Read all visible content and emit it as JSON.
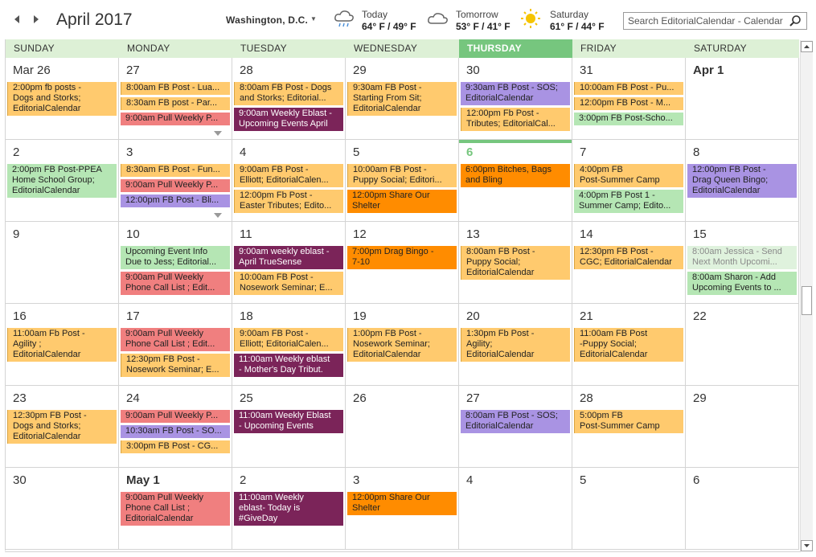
{
  "header": {
    "month_title": "April 2017",
    "location": "Washington,  D.C.",
    "weather": [
      {
        "label": "Today",
        "temp": "64° F / 49° F",
        "icon": "rain-cloud-icon"
      },
      {
        "label": "Tomorrow",
        "temp": "53° F / 41° F",
        "icon": "cloud-icon"
      },
      {
        "label": "Saturday",
        "temp": "61° F / 44° F",
        "icon": "sun-icon"
      }
    ],
    "search_placeholder": "Search EditorialCalendar - Calendar ..."
  },
  "days_of_week": [
    "SUNDAY",
    "MONDAY",
    "TUESDAY",
    "WEDNESDAY",
    "THURSDAY",
    "FRIDAY",
    "SATURDAY"
  ],
  "today_index": 4,
  "colors": {
    "yellow": "#ffca6e",
    "red": "#f07f7f",
    "purple": "#a993e3",
    "plum": "#7b2459",
    "orange": "#ff8c00",
    "green": "#b5e6b4",
    "today_green": "#76c67e",
    "header_bg": "#ddf0d6"
  },
  "weeks": [
    {
      "days": [
        {
          "label": "Mar 26",
          "events": [
            {
              "text": "2:00pm fb posts -\nDogs and Storks;\nEditorialCalendar",
              "color": "yellow",
              "lines": 3
            }
          ]
        },
        {
          "label": "27",
          "more": true,
          "events": [
            {
              "text": "8:00am FB Post - Lua...",
              "color": "yellow",
              "lines": 1
            },
            {
              "text": "8:30am FB post - Par...",
              "color": "yellow",
              "lines": 1
            },
            {
              "text": "9:00am Pull Weekly P...",
              "color": "red",
              "lines": 1
            }
          ]
        },
        {
          "label": "28",
          "events": [
            {
              "text": "8:00am FB Post - Dogs\nand Storks; Editorial...",
              "color": "yellow",
              "lines": 2
            },
            {
              "text": "9:00am Weekly Eblast -\nUpcoming Events April",
              "color": "plum",
              "lines": 2
            }
          ]
        },
        {
          "label": "29",
          "events": [
            {
              "text": "9:30am FB Post -\nStarting From Sit;\nEditorialCalendar",
              "color": "yellow",
              "lines": 3
            }
          ]
        },
        {
          "label": "30",
          "events": [
            {
              "text": "9:30am FB Post - SOS;\nEditorialCalendar",
              "color": "purple",
              "lines": 2
            },
            {
              "text": "12:00pm Fb Post -\nTributes; EditorialCal...",
              "color": "yellow",
              "lines": 2
            }
          ]
        },
        {
          "label": "31",
          "events": [
            {
              "text": "10:00am FB Post - Pu...",
              "color": "yellow",
              "lines": 1
            },
            {
              "text": "12:00pm FB Post - M...",
              "color": "yellow",
              "lines": 1
            },
            {
              "text": "3:00pm FB Post-Scho...",
              "color": "green",
              "lines": 1
            }
          ]
        },
        {
          "label": "Apr 1",
          "bold": true,
          "events": []
        }
      ]
    },
    {
      "days": [
        {
          "label": "2",
          "events": [
            {
              "text": "2:00pm FB Post-PPEA\nHome School Group;\nEditorialCalendar",
              "color": "green",
              "lines": 3
            }
          ]
        },
        {
          "label": "3",
          "more": true,
          "events": [
            {
              "text": "8:30am FB Post - Fun...",
              "color": "yellow",
              "lines": 1
            },
            {
              "text": "9:00am Pull Weekly P...",
              "color": "red",
              "lines": 1
            },
            {
              "text": "12:00pm FB Post - Bli...",
              "color": "purple",
              "lines": 1
            }
          ]
        },
        {
          "label": "4",
          "events": [
            {
              "text": "9:00am FB Post -\nElliott; EditorialCalen...",
              "color": "yellow",
              "lines": 2
            },
            {
              "text": "12:00pm Fb Post -\nEaster Tributes; Edito...",
              "color": "yellow",
              "lines": 2
            }
          ]
        },
        {
          "label": "5",
          "events": [
            {
              "text": "10:00am FB Post -\nPuppy Social; Editori...",
              "color": "yellow",
              "lines": 2
            },
            {
              "text": "12:00pm Share Our\nShelter",
              "color": "orange",
              "lines": 2
            }
          ]
        },
        {
          "label": "6",
          "today": true,
          "events": [
            {
              "text": "6:00pm Bitches, Bags\nand Bling",
              "color": "orange",
              "lines": 2
            }
          ]
        },
        {
          "label": "7",
          "events": [
            {
              "text": "4:00pm FB\nPost-Summer Camp",
              "color": "yellow",
              "lines": 2
            },
            {
              "text": "4:00pm FB Post 1 -\nSummer Camp; Edito...",
              "color": "green",
              "lines": 2
            }
          ]
        },
        {
          "label": "8",
          "events": [
            {
              "text": "12:00pm FB Post -\nDrag Queen Bingo;\nEditorialCalendar",
              "color": "purple",
              "lines": 3
            }
          ]
        }
      ]
    },
    {
      "days": [
        {
          "label": "9",
          "events": []
        },
        {
          "label": "10",
          "events": [
            {
              "text": "Upcoming Event Info\nDue to Jess; Editorial...",
              "color": "green",
              "lines": 2
            },
            {
              "text": "9:00am Pull Weekly\nPhone Call List ; Edit...",
              "color": "red",
              "lines": 2
            }
          ]
        },
        {
          "label": "11",
          "events": [
            {
              "text": "9:00am weekly eblast -\nApril TrueSense",
              "color": "plum",
              "lines": 2
            },
            {
              "text": "10:00am FB Post -\nNosework Seminar; E...",
              "color": "yellow",
              "lines": 2
            }
          ]
        },
        {
          "label": "12",
          "events": [
            {
              "text": "7:00pm Drag Bingo -\n7-10",
              "color": "orange",
              "lines": 2
            }
          ]
        },
        {
          "label": "13",
          "events": [
            {
              "text": "8:00am FB Post -\nPuppy Social;\nEditorialCalendar",
              "color": "yellow",
              "lines": 3
            }
          ]
        },
        {
          "label": "14",
          "events": [
            {
              "text": "12:30pm FB Post -\nCGC; EditorialCalendar",
              "color": "yellow",
              "lines": 2
            }
          ]
        },
        {
          "label": "15",
          "events": [
            {
              "text": "8:00am Jessica - Send\nNext Month Upcomi...",
              "color": "pale",
              "lines": 2
            },
            {
              "text": "8:00am Sharon - Add\nUpcoming Events to ...",
              "color": "green",
              "lines": 2
            }
          ]
        }
      ]
    },
    {
      "days": [
        {
          "label": "16",
          "events": [
            {
              "text": "11:00am Fb Post -\nAgility ;\nEditorialCalendar",
              "color": "yellow",
              "lines": 3
            }
          ]
        },
        {
          "label": "17",
          "events": [
            {
              "text": "9:00am Pull Weekly\nPhone Call List ; Edit...",
              "color": "red",
              "lines": 2
            },
            {
              "text": "12:30pm FB Post -\nNosework Seminar; E...",
              "color": "yellow",
              "lines": 2
            }
          ]
        },
        {
          "label": "18",
          "events": [
            {
              "text": "9:00am FB Post -\nElliott; EditorialCalen...",
              "color": "yellow",
              "lines": 2
            },
            {
              "text": "11:00am Weekly eblast\n- Mother's Day Tribut.",
              "color": "plum",
              "lines": 2
            }
          ]
        },
        {
          "label": "19",
          "events": [
            {
              "text": "1:00pm FB Post -\nNosework Seminar;\nEditorialCalendar",
              "color": "yellow",
              "lines": 3
            }
          ]
        },
        {
          "label": "20",
          "events": [
            {
              "text": "1:30pm Fb Post -\nAgility;\nEditorialCalendar",
              "color": "yellow",
              "lines": 3
            }
          ]
        },
        {
          "label": "21",
          "events": [
            {
              "text": "11:00am FB Post\n-Puppy Social;\nEditorialCalendar",
              "color": "yellow",
              "lines": 3
            }
          ]
        },
        {
          "label": "22",
          "events": []
        }
      ]
    },
    {
      "days": [
        {
          "label": "23",
          "events": [
            {
              "text": "12:30pm FB Post -\nDogs and Storks;\nEditorialCalendar",
              "color": "yellow",
              "lines": 3
            }
          ]
        },
        {
          "label": "24",
          "events": [
            {
              "text": "9:00am Pull Weekly P...",
              "color": "red",
              "lines": 1
            },
            {
              "text": "10:30am FB Post - SO...",
              "color": "purple",
              "lines": 1
            },
            {
              "text": "3:00pm FB Post - CG...",
              "color": "yellow",
              "lines": 1
            }
          ]
        },
        {
          "label": "25",
          "events": [
            {
              "text": "11:00am Weekly Eblast\n- Upcoming Events",
              "color": "plum",
              "lines": 2
            }
          ]
        },
        {
          "label": "26",
          "events": []
        },
        {
          "label": "27",
          "events": [
            {
              "text": "8:00am FB Post - SOS;\nEditorialCalendar",
              "color": "purple",
              "lines": 2
            }
          ]
        },
        {
          "label": "28",
          "events": [
            {
              "text": "5:00pm FB\nPost-Summer Camp",
              "color": "yellow",
              "lines": 2
            }
          ]
        },
        {
          "label": "29",
          "events": []
        }
      ]
    },
    {
      "days": [
        {
          "label": "30",
          "events": []
        },
        {
          "label": "May 1",
          "bold": true,
          "events": [
            {
              "text": "9:00am Pull Weekly\nPhone Call List ;\nEditorialCalendar",
              "color": "red",
              "lines": 3
            }
          ]
        },
        {
          "label": "2",
          "events": [
            {
              "text": "11:00am Weekly\neblast- Today is\n#GiveDay",
              "color": "plum",
              "lines": 3
            }
          ]
        },
        {
          "label": "3",
          "events": [
            {
              "text": "12:00pm Share Our\nShelter",
              "color": "orange",
              "lines": 2
            }
          ]
        },
        {
          "label": "4",
          "events": []
        },
        {
          "label": "5",
          "events": []
        },
        {
          "label": "6",
          "events": []
        }
      ]
    }
  ]
}
